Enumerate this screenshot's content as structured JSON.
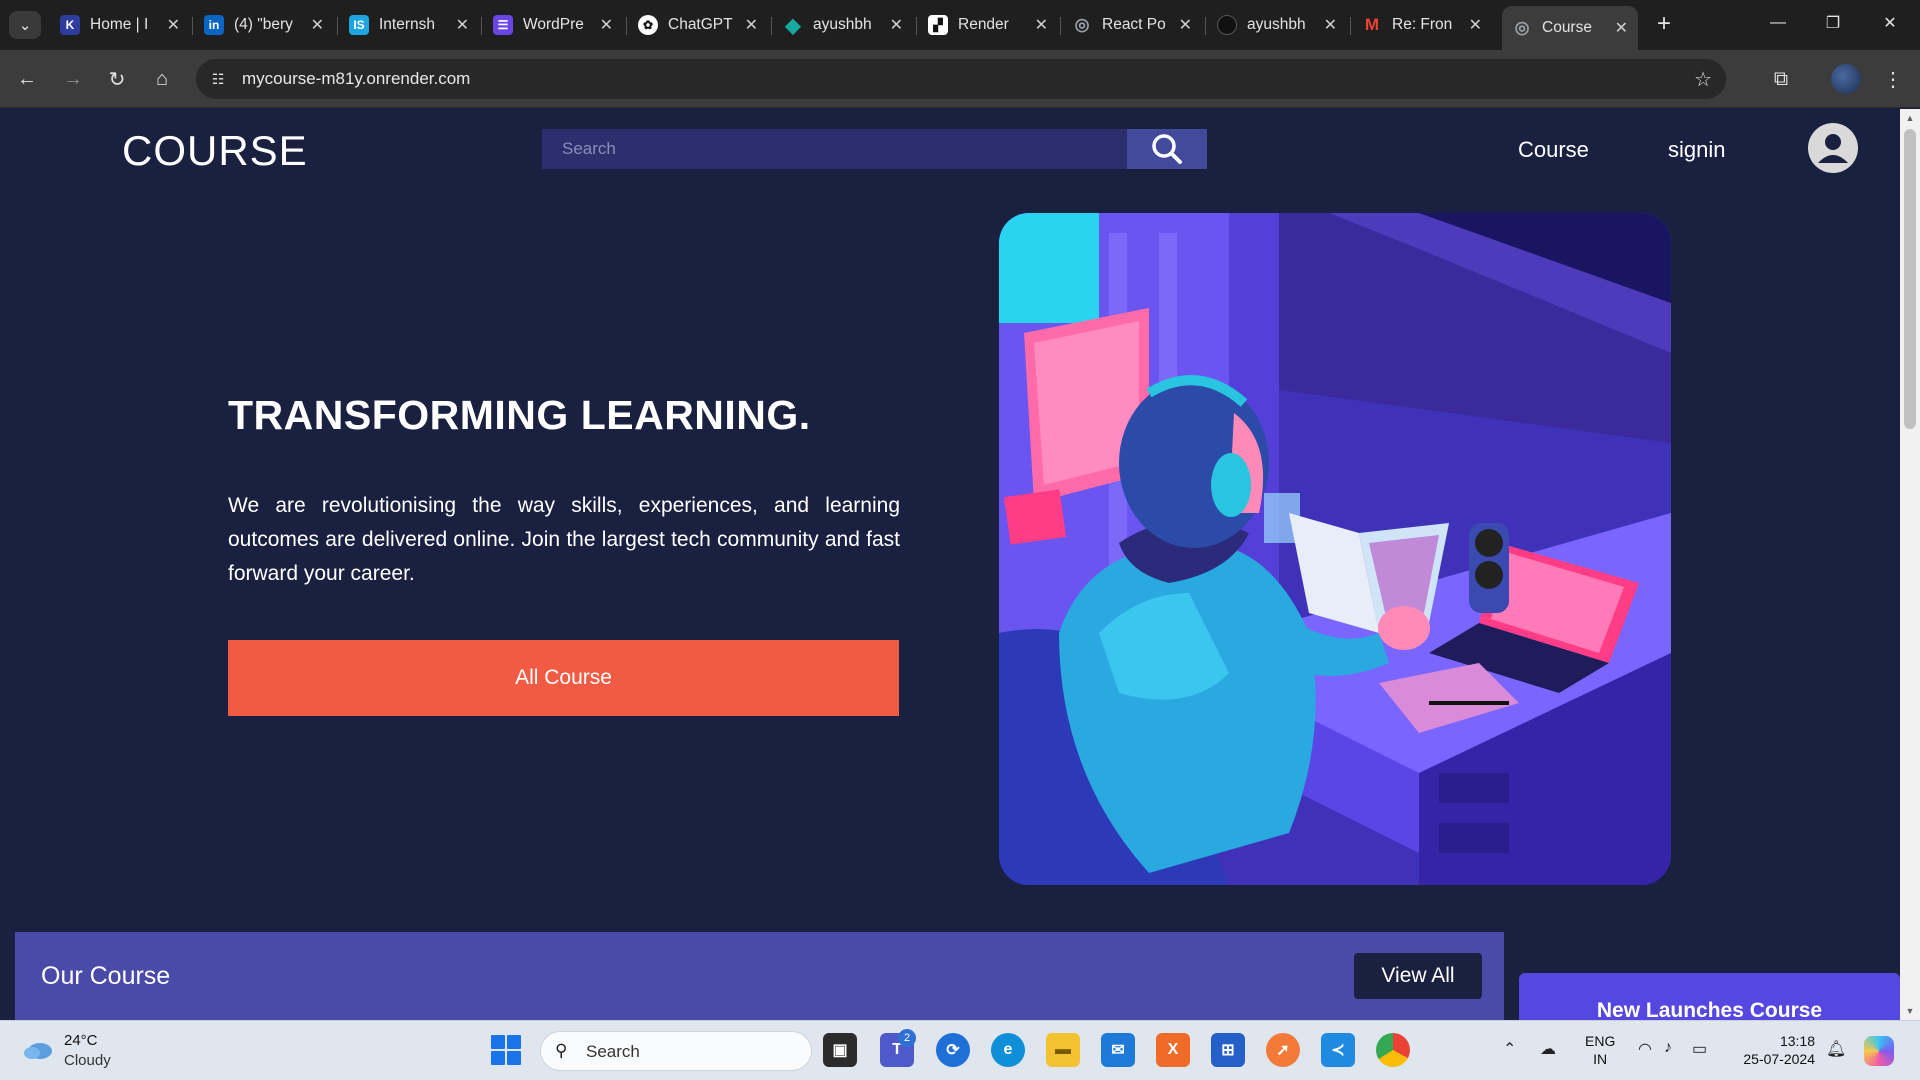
{
  "browser": {
    "tabs": [
      {
        "label": "Home | I",
        "icon": "kotlin-icon",
        "color": "#5a7cff"
      },
      {
        "label": "(4) \"bery",
        "icon": "linkedin-icon",
        "color": "#0a66c2"
      },
      {
        "label": "Internsh",
        "icon": "internshala-icon",
        "color": "#1ea5e0"
      },
      {
        "label": "WordPre",
        "icon": "wordpress-forms-icon",
        "color": "#6b46e5"
      },
      {
        "label": "ChatGPT",
        "icon": "chatgpt-icon",
        "color": "#444444"
      },
      {
        "label": "ayushbh",
        "icon": "diamond-icon",
        "color": "#17a9a0"
      },
      {
        "label": "Render",
        "icon": "render-icon",
        "color": "#111111"
      },
      {
        "label": "React Po",
        "icon": "globe-icon",
        "color": "#555555"
      },
      {
        "label": "ayushbh",
        "icon": "github-icon",
        "color": "#222222"
      },
      {
        "label": "Re: Fron",
        "icon": "gmail-icon",
        "color": "#ea4335"
      },
      {
        "label": "Course",
        "icon": "globe-icon",
        "color": "#555555",
        "active": true
      }
    ],
    "url": "mycourse-m81y.onrender.com"
  },
  "header": {
    "logo": "COURSE",
    "search_placeholder": "Search",
    "nav": [
      "Course",
      "signin"
    ]
  },
  "hero": {
    "title": "TRANSFORMING LEARNING.",
    "text": "We are revolutionising the way skills, experiences, and learning outcomes are delivered online. Join the largest tech community and fast forward your career.",
    "button": "All Course"
  },
  "courses": {
    "title": "Our Course",
    "view_all": "View All",
    "new_launches": "New Launches Course"
  },
  "taskbar": {
    "temp": "24°C",
    "condition": "Cloudy",
    "search": "Search",
    "teams_badge": "2",
    "lang_1": "ENG",
    "lang_2": "IN",
    "time": "13:18",
    "date": "25-07-2024"
  },
  "colors": {
    "page_bg": "#1a2040",
    "accent_button": "#f15a43",
    "course_panel": "#4a4aa8",
    "new_launches": "#5548e0"
  }
}
